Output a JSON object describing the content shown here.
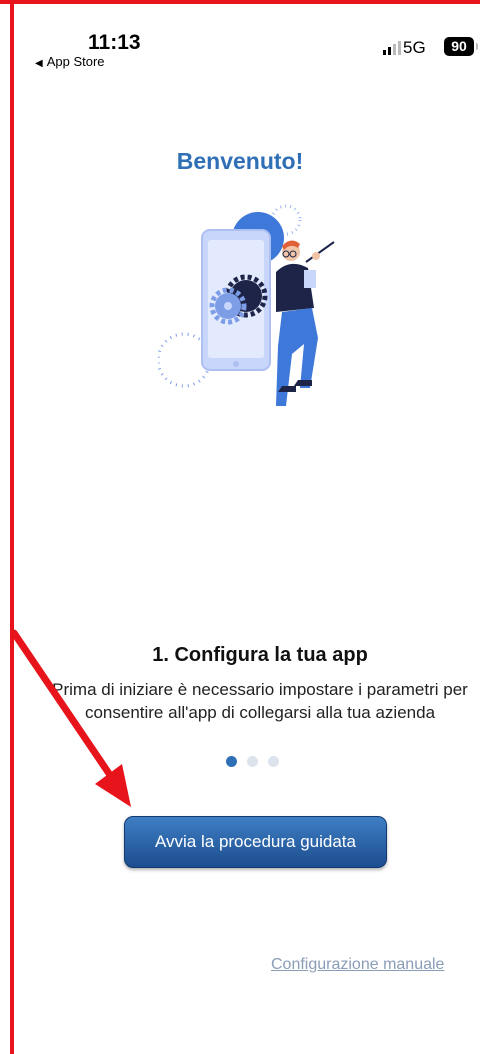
{
  "status_bar": {
    "time": "11:13",
    "back_label": "App Store",
    "network": "5G",
    "battery": "90"
  },
  "welcome": {
    "title": "Benvenuto!"
  },
  "slide": {
    "heading": "1. Configura la tua app",
    "body": "Prima di iniziare è necessario impostare i parametri per consentire all'app di collegarsi alla tua azienda",
    "current_page": 1,
    "page_count": 3
  },
  "actions": {
    "primary_label": "Avvia la procedura guidata",
    "manual_label": "Configurazione manuale"
  },
  "colors": {
    "accent": "#2f6fb6",
    "annotation": "#e8141b"
  }
}
